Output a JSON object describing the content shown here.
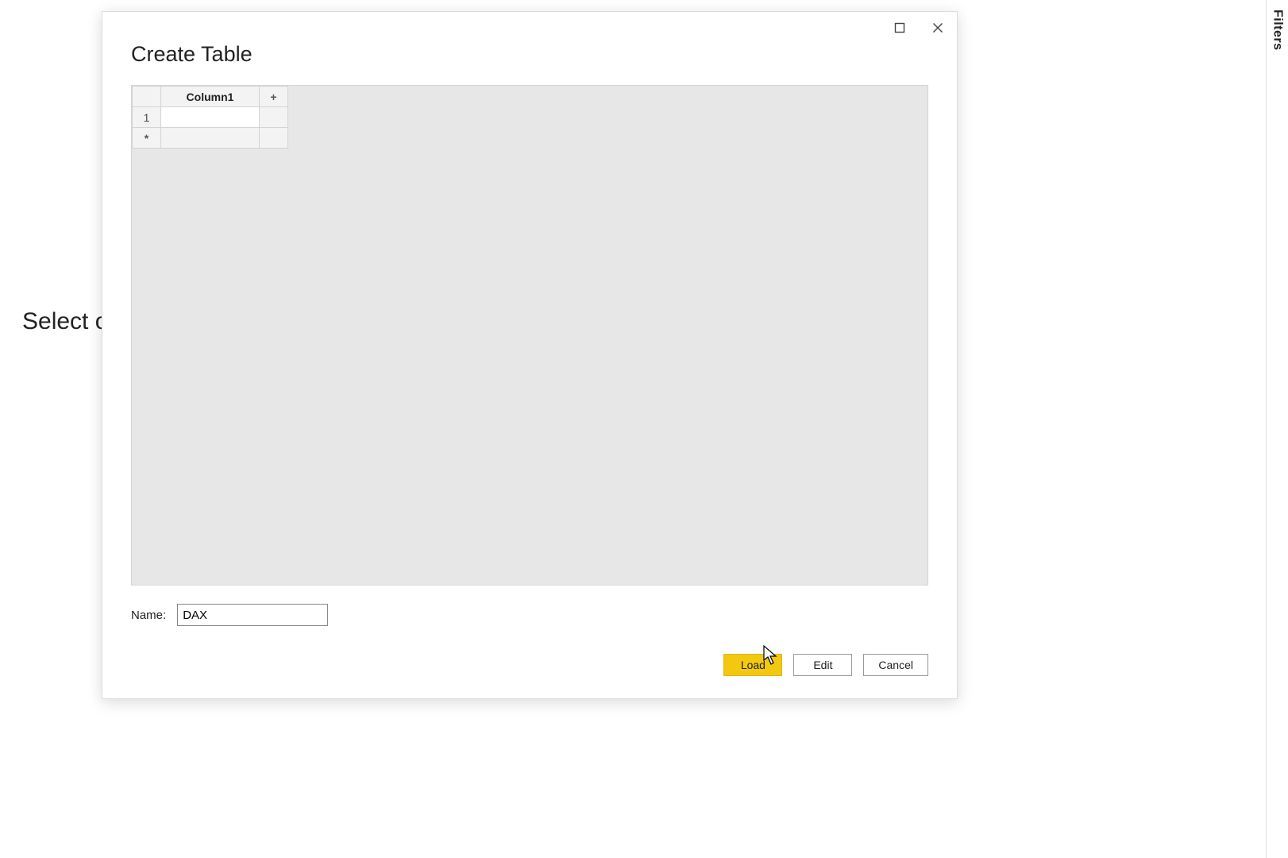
{
  "background": {
    "partial_text": "Select o"
  },
  "filters_pane": {
    "label": "Filters"
  },
  "dialog": {
    "title": "Create Table",
    "grid": {
      "row_header": "1",
      "column_header": "Column1",
      "add_column_label": "+",
      "add_row_label": "*"
    },
    "name_field": {
      "label": "Name:",
      "value": "DAX"
    },
    "buttons": {
      "load": "Load",
      "edit": "Edit",
      "cancel": "Cancel"
    }
  }
}
